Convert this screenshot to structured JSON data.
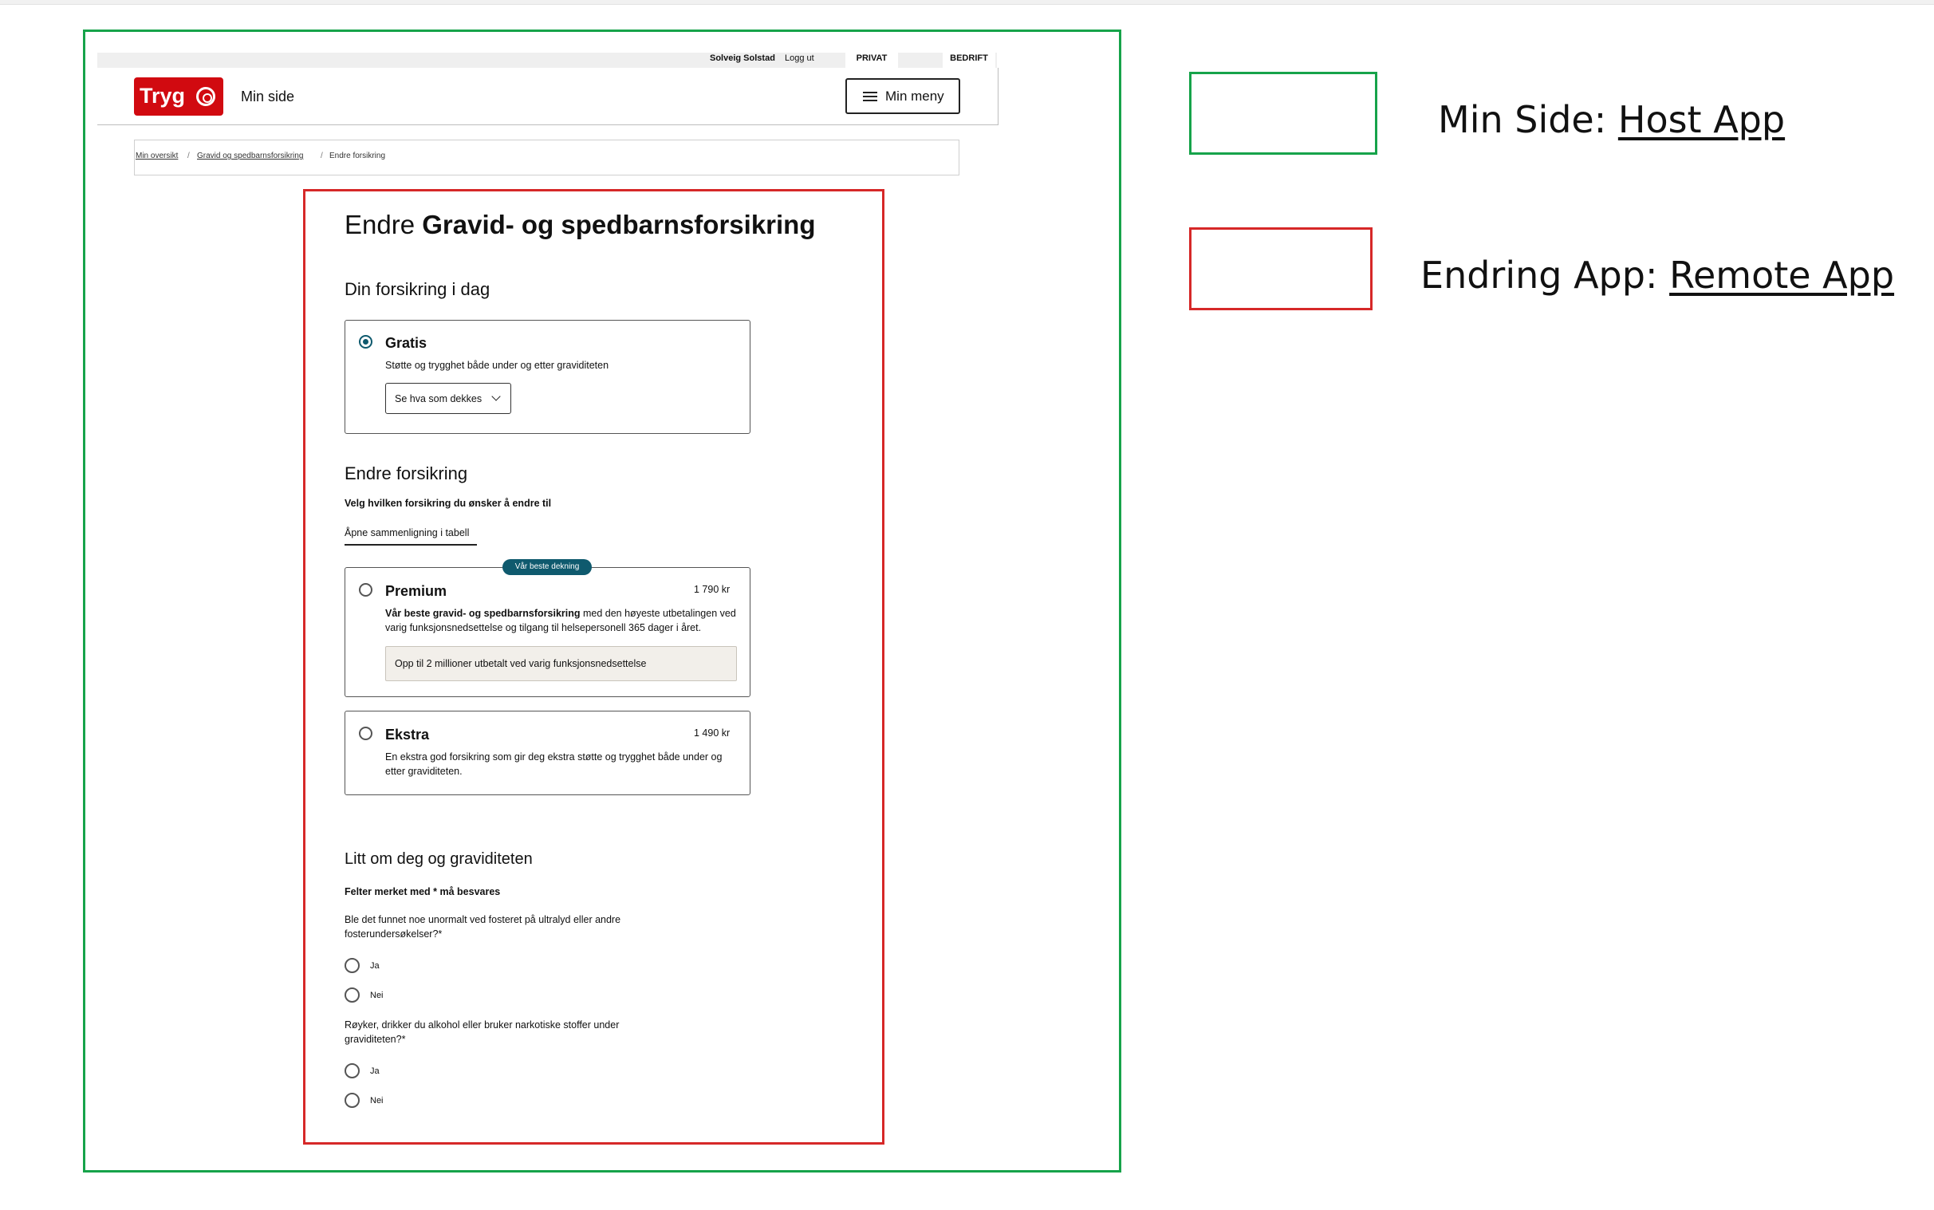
{
  "host": {
    "utility": {
      "user_name": "Solveig Solstad",
      "logout": "Logg ut",
      "tab_private": "PRIVAT",
      "tab_business": "BEDRIFT"
    },
    "logo_text": "Tryg",
    "title": "Min side",
    "menu_button": "Min meny",
    "breadcrumb": [
      "Min oversikt",
      "/",
      "Gravid og spedbarnsforsikring",
      "/",
      "Endre forsikring"
    ]
  },
  "remote": {
    "title_prefix": "Endre",
    "title_bold": "Gravid- og spedbarnsforsikring",
    "current": {
      "heading": "Din forsikring i dag",
      "plan_name": "Gratis",
      "plan_desc": "Støtte og trygghet både under og etter graviditeten",
      "coverage_button": "Se hva som dekkes"
    },
    "change": {
      "heading": "Endre forsikring",
      "subheading": "Velg hvilken forsikring du ønsker å endre til",
      "compare_link": "Åpne sammenligning i tabell",
      "options": [
        {
          "badge": "Vår beste dekning",
          "name": "Premium",
          "price": "1 790 kr",
          "desc_bold": "Vår beste gravid- og spedbarnsforsikring",
          "desc_line1_rest": " med den høyeste utbetalingen ved",
          "desc_line2": "varig funksjonsnedsettelse og tilgang til helsepersonell 365 dager i året.",
          "highlight": "Opp til 2 millioner utbetalt ved varig funksjonsnedsettelse"
        },
        {
          "name": "Ekstra",
          "price": "1 490 kr",
          "desc_line1": "En ekstra god forsikring som gir deg ekstra støtte og trygghet både under og",
          "desc_line2": "etter graviditeten."
        }
      ]
    },
    "about": {
      "heading": "Litt om deg og graviditeten",
      "required_note": "Felter merket med * må besvares",
      "questions": [
        {
          "line1": "Ble det funnet noe unormalt ved fosteret på ultralyd eller andre",
          "line2": "fosterundersøkelser?*",
          "yes": "Ja",
          "no": "Nei"
        },
        {
          "line1": "Røyker, drikker du alkohol eller bruker narkotiske stoffer under",
          "line2": "graviditeten?*",
          "yes": "Ja",
          "no": "Nei"
        }
      ]
    }
  },
  "legend": [
    {
      "prefix": "Min Side: ",
      "link": "Host App",
      "color": "#16a34a"
    },
    {
      "prefix": "Endring App: ",
      "link": "Remote App",
      "color": "#d62828"
    }
  ],
  "colors": {
    "brand_red": "#d10a10",
    "accent_teal": "#0f5a6e"
  }
}
